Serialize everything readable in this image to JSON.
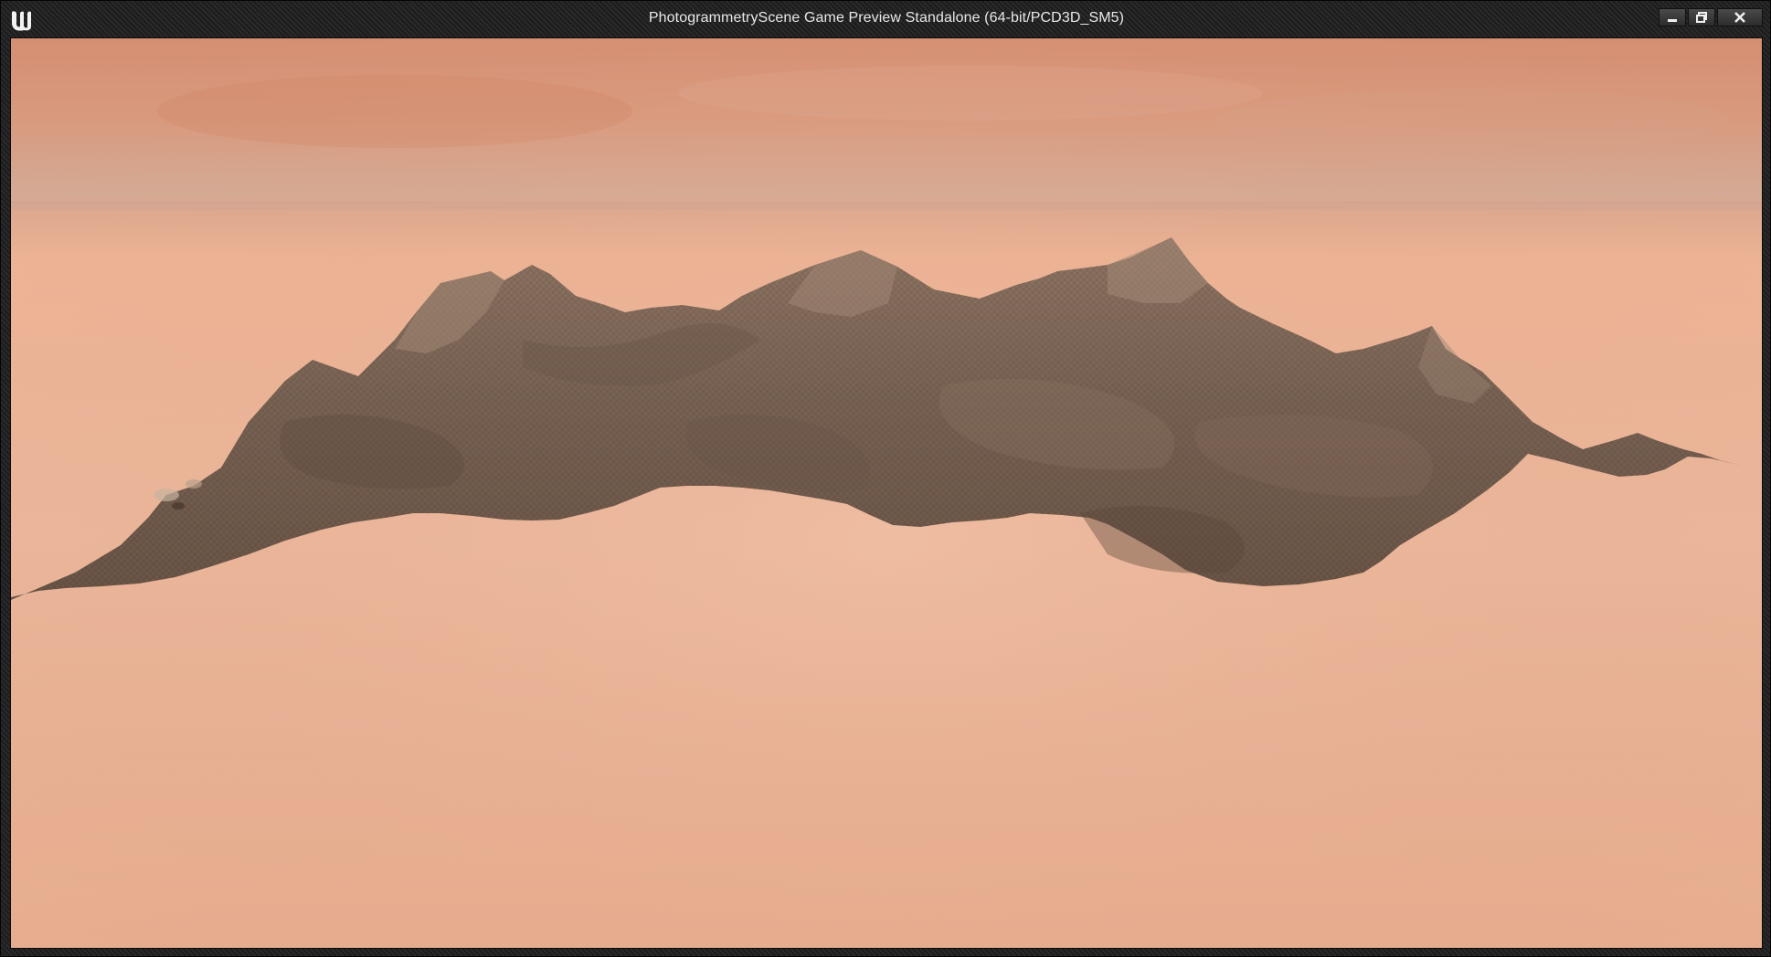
{
  "window": {
    "title": "PhotogrammetryScene Game Preview Standalone (64-bit/PCD3D_SM5)",
    "app_icon": "unreal-engine-logo-icon",
    "controls": {
      "minimize_icon": "minimize-icon",
      "restore_icon": "restore-icon",
      "close_icon": "close-icon"
    }
  },
  "viewport": {
    "scene": "terrain-mesh",
    "colors": {
      "sky_top": "#d89a7e",
      "sky_horizon": "#d2ad98",
      "ground_fog": "#eab79c",
      "terrain": "#7a6556"
    }
  }
}
